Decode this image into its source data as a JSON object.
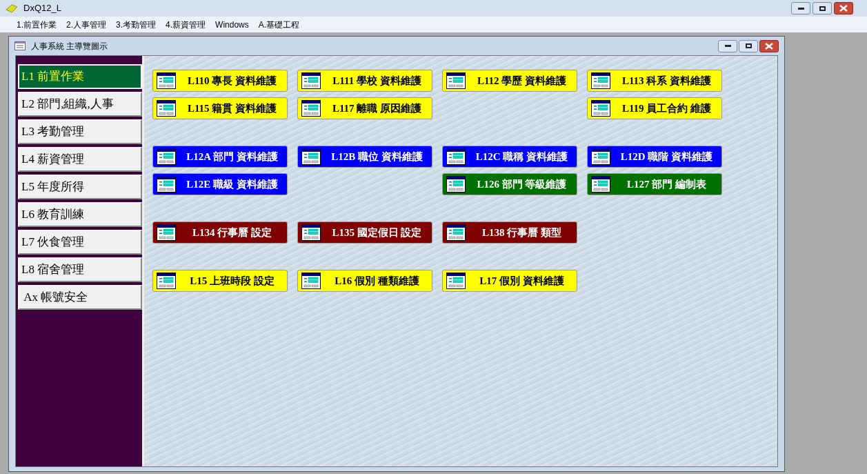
{
  "app_window": {
    "title": "DxQ12_L"
  },
  "menu": [
    "1.前置作業",
    "2.人事管理",
    "3.考勤管理",
    "4.薪資管理",
    "Windows",
    "A.基礎工程"
  ],
  "child_window": {
    "title": "人事系統 主導覽圖示"
  },
  "sidebar": {
    "items": [
      {
        "label": "L1 前置作業",
        "selected": true
      },
      {
        "label": "L2 部門,組織,人事",
        "selected": false
      },
      {
        "label": "L3 考勤管理",
        "selected": false
      },
      {
        "label": "L4 薪資管理",
        "selected": false
      },
      {
        "label": "L5 年度所得",
        "selected": false
      },
      {
        "label": "L6 教育訓練",
        "selected": false
      },
      {
        "label": "L7 伙食管理",
        "selected": false
      },
      {
        "label": "L8 宿舍管理",
        "selected": false
      },
      {
        "label": " Ax 帳號安全",
        "selected": false
      }
    ]
  },
  "groups": [
    {
      "rows": [
        [
          {
            "kind": "button",
            "label": "L110 專長 資料維護",
            "color": "#ffff00"
          },
          {
            "kind": "button",
            "label": "L111 學校 資料維護",
            "color": "#ffff00"
          },
          {
            "kind": "button",
            "label": "L112 學歷 資料維護",
            "color": "#ffff00"
          },
          {
            "kind": "button",
            "label": "L113 科系 資料維護",
            "color": "#ffff00"
          }
        ],
        [
          {
            "kind": "button",
            "label": "L115 籍貫 資料維護",
            "color": "#ffff00"
          },
          {
            "kind": "button",
            "label": "L117 離職 原因維護",
            "color": "#ffff00"
          },
          {
            "kind": "empty"
          },
          {
            "kind": "button",
            "label": "L119 員工合約 維護",
            "color": "#ffff00"
          }
        ]
      ]
    },
    {
      "rows": [
        [
          {
            "kind": "button",
            "label": "L12A 部門 資料維護",
            "color": "#0000ff"
          },
          {
            "kind": "button",
            "label": "L12B 職位 資料維護",
            "color": "#0000ff"
          },
          {
            "kind": "button",
            "label": "L12C 職稱 資料維護",
            "color": "#0000ff"
          },
          {
            "kind": "button",
            "label": "L12D 職階 資料維護",
            "color": "#0000ff"
          }
        ],
        [
          {
            "kind": "button",
            "label": "L12E 職級 資料維護",
            "color": "#0000ff"
          },
          {
            "kind": "empty"
          },
          {
            "kind": "button",
            "label": "L126 部門 等級維護",
            "color": "#007000"
          },
          {
            "kind": "button",
            "label": "L127 部門 編制表",
            "color": "#007000"
          }
        ]
      ]
    },
    {
      "rows": [
        [
          {
            "kind": "button",
            "label": "L134 行事曆 設定",
            "color": "#800000"
          },
          {
            "kind": "button",
            "label": "L135 國定假日 設定",
            "color": "#800000"
          },
          {
            "kind": "button",
            "label": "L138 行事曆 類型",
            "color": "#800000"
          }
        ]
      ]
    },
    {
      "rows": [
        [
          {
            "kind": "button",
            "label": "L15 上班時段 設定",
            "color": "#ffff00"
          },
          {
            "kind": "button",
            "label": "L16 假別 種類維護",
            "color": "#ffff00"
          },
          {
            "kind": "button",
            "label": "L17 假別 資料維護",
            "color": "#ffff00"
          }
        ]
      ]
    }
  ]
}
